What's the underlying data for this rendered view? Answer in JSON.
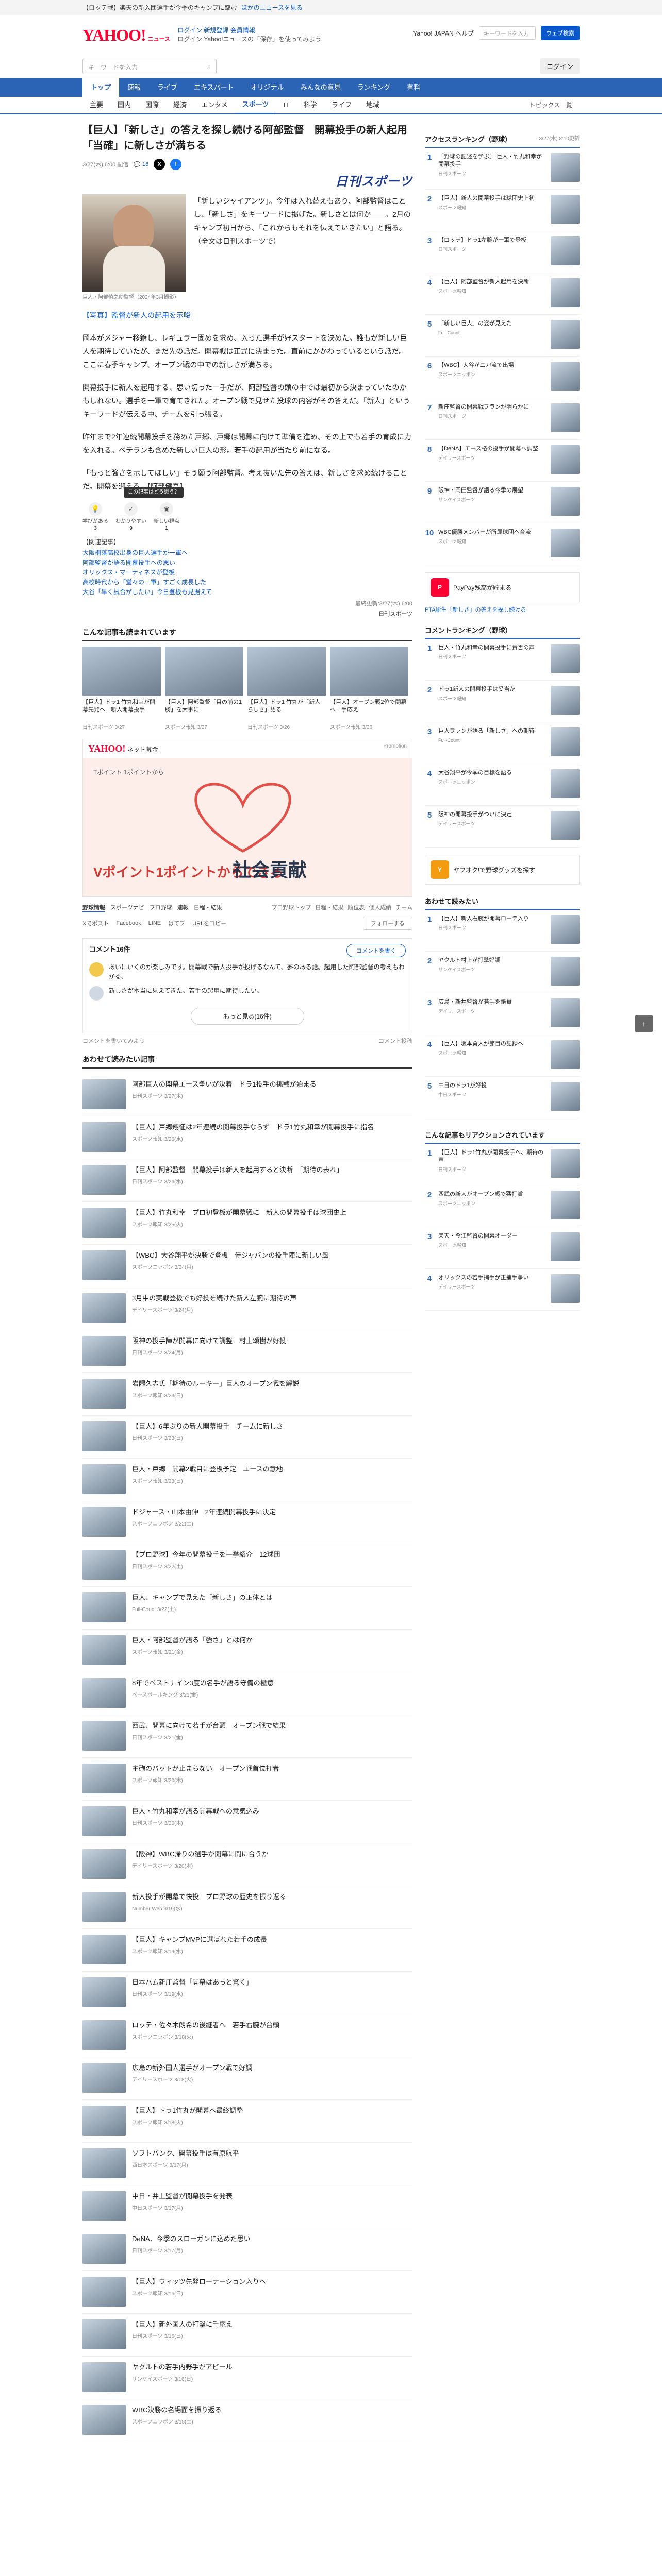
{
  "promo": {
    "text": "【ロッテ戦】楽天の新入団選手が今季のキャンプに臨む",
    "link": "ほかのニュースを見る"
  },
  "header": {
    "logo": "YAHOO!",
    "logo_sub": "ニュース",
    "links_1": "ログイン 新規登録 会員情報",
    "links_2": "ログイン Yahoo!ニュースの「保存」を使ってみよう",
    "right_links": "Yahoo! JAPAN ヘルプ",
    "search_placeholder": "キーワードを入力",
    "search_button": "ウェブ検索"
  },
  "search": {
    "placeholder": "キーワードを入力",
    "right": "ヘルプ",
    "login": "ログイン"
  },
  "gnav": [
    "トップ",
    "速報",
    "ライブ",
    "エキスパート",
    "オリジナル",
    "みんなの意見",
    "ランキング",
    "有料"
  ],
  "snav": [
    "主要",
    "国内",
    "国際",
    "経済",
    "エンタメ",
    "スポーツ",
    "IT",
    "科学",
    "ライフ",
    "地域"
  ],
  "snav_right": "トピックス一覧",
  "article": {
    "title": "【巨人】「新しさ」の答えを探し続ける阿部監督　開幕投手の新人起用「当確」に新しさが満ちる",
    "date": "3/27(木) 6:00 配信",
    "comments": "16",
    "publisher": "日刊スポーツ",
    "caption": "巨人・阿部慎之助監督（2024年3月撮影）",
    "lead": "「新しいジャイアンツ」。今年は入れ替えもあり、阿部監督はことし、「新しさ」をキーワードに掲げた。新しさとは何か――。2月のキャンプ初日から、「これからもそれを伝えていきたい」と語る。（全文は日刊スポーツで）",
    "paras": [
      "【写真】監督が新人の起用を示唆",
      "岡本がメジャー移籍し、レギュラー固めを求め、入った選手が好スタートを決めた。誰もが新しい巨人を期待していたが、まだ先の話だ。開幕戦は正式に決まった。直前にかかわっているという話だ。ここに春季キャンプ、オープン戦の中での新しさが満ちる。",
      "開幕投手に新人を起用する、思い切った一手だが、阿部監督の頭の中では最初から決まっていたのかもしれない。選手を一軍で育てきれた。オープン戦で見せた投球の内容がその答えだ。「新人」というキーワードが伝える中、チームを引っ張る。",
      "昨年まで2年連続開幕投手を務めた戸郷、戸郷は開幕に向けて準備を進め、その上でも若手の育成に力を入れる。ベテランも含めた新しい巨人の形。若手の起用が当たり前になる。",
      "「もっと強さを示してほしい」そう願う阿部監督。考え抜いた先の答えは、新しさを求め続けることだ。開幕を迎える。【阿部健吾】"
    ],
    "react_tip": "この記事はどう思う？",
    "reactions": [
      {
        "label": "学びがある",
        "n": "3"
      },
      {
        "label": "わかりやすい",
        "n": "9"
      },
      {
        "label": "新しい視点",
        "n": "1"
      }
    ],
    "related_head": "【関連記事】",
    "related": [
      "大阪桐蔭高校出身の巨人選手が一軍へ",
      "阿部監督が語る開幕投手への思い",
      "オリックス・マーティネスが登板",
      "高校時代から「堂々の一軍」すごく成長した",
      "大谷「早く試合がしたい」今日登板も見据えて"
    ],
    "updated": "最終更新:3/27(木) 6:00",
    "source": "日刊スポーツ"
  },
  "also_read": {
    "head": "こんな記事も読まれています",
    "cards": [
      {
        "t": "【巨人】ドラ1 竹丸和幸が開幕先発へ　新人開幕投手",
        "s": "日刊スポーツ 3/27"
      },
      {
        "t": "【巨人】阿部監督「目の前の1勝」を大事に",
        "s": "スポーツ報知 3/27"
      },
      {
        "t": "【巨人】ドラ1 竹丸が「新人らしさ」語る",
        "s": "日刊スポーツ 3/26"
      },
      {
        "t": "【巨人】オープン戦2位で開幕へ　手応え",
        "s": "スポーツ報知 3/26"
      }
    ]
  },
  "ad": {
    "brand": "YAHOO!",
    "brand_sub": "ネット募金",
    "pr": "Promotion",
    "caption": "Tポイント 1ポイントから",
    "big_left": "Vポイント1ポイントからできる",
    "big_right": "社会貢献"
  },
  "ranking_bar": {
    "label": "野球情報",
    "tabs": [
      "スポーツナビ",
      "プロ野球",
      "速報",
      "日程・結果"
    ],
    "right": [
      "プロ野球トップ",
      "日程・結果",
      "順位表",
      "個人成績",
      "チーム"
    ]
  },
  "share": {
    "items": [
      "Xでポスト",
      "Facebook",
      "LINE",
      "はてブ",
      "URLをコピー"
    ],
    "follow": "フォローする"
  },
  "comments": {
    "head": "コメント16件",
    "button": "コメントを書く",
    "items": [
      "あいにいくのが楽しみです。開幕戦で新人投手が投げるなんて、夢のある話。起用した阿部監督の考えもわかる。",
      "新しさが本当に見えてきた。若手の起用に期待したい。"
    ],
    "more": "もっと見る(16件)",
    "note_left": "コメントを書いてみよう",
    "note_right": "コメント投稿"
  },
  "reco": {
    "head": "あわせて読みたい記事",
    "items": [
      {
        "t": "阿部巨人の開幕エース争いが決着　ドラ1投手の挑戦が始まる",
        "s": "日刊スポーツ 3/27(木)"
      },
      {
        "t": "【巨人】戸郷翔征は2年連続の開幕投手ならず　ドラ1竹丸和幸が開幕投手に指名",
        "s": "スポーツ報知 3/26(水)"
      },
      {
        "t": "【巨人】阿部監督　開幕投手は新人を起用すると決断　「期待の表れ」",
        "s": "日刊スポーツ 3/26(水)"
      },
      {
        "t": "【巨人】竹丸和幸　プロ初登板が開幕戦に　新人の開幕投手は球団史上",
        "s": "スポーツ報知 3/25(火)"
      },
      {
        "t": "【WBC】大谷翔平が決勝で登板　侍ジャパンの投手陣に新しい風",
        "s": "スポーツニッポン 3/24(月)"
      },
      {
        "t": "3月中の実戦登板でも好投を続けた新人左腕に期待の声",
        "s": "デイリースポーツ 3/24(月)"
      },
      {
        "t": "阪神の投手陣が開幕に向けて調整　村上頌樹が好投",
        "s": "日刊スポーツ 3/24(月)"
      },
      {
        "t": "岩隈久志氏「期待のルーキー」巨人のオープン戦を解説",
        "s": "スポーツ報知 3/23(日)"
      },
      {
        "t": "【巨人】6年ぶりの新人開幕投手　チームに新しさ",
        "s": "日刊スポーツ 3/23(日)"
      },
      {
        "t": "巨人・戸郷　開幕2戦目に登板予定　エースの意地",
        "s": "スポーツ報知 3/23(日)"
      },
      {
        "t": "ドジャース・山本由伸　2年連続開幕投手に決定",
        "s": "スポーツニッポン 3/22(土)"
      },
      {
        "t": "【プロ野球】今年の開幕投手を一挙紹介　12球団",
        "s": "日刊スポーツ 3/22(土)"
      },
      {
        "t": "巨人、キャンプで見えた「新しさ」の正体とは",
        "s": "Full-Count 3/22(土)"
      },
      {
        "t": "巨人・阿部監督が語る「強さ」とは何か",
        "s": "スポーツ報知 3/21(金)"
      },
      {
        "t": "8年でベストナイン3度の名手が語る守備の極意",
        "s": "ベースボールキング 3/21(金)"
      },
      {
        "t": "西武、開幕に向けて若手が台頭　オープン戦で結果",
        "s": "日刊スポーツ 3/21(金)"
      },
      {
        "t": "主砲のバットが止まらない　オープン戦首位打者",
        "s": "スポーツ報知 3/20(木)"
      },
      {
        "t": "巨人・竹丸和幸が語る開幕戦への意気込み",
        "s": "日刊スポーツ 3/20(木)"
      },
      {
        "t": "【阪神】WBC帰りの選手が開幕に間に合うか",
        "s": "デイリースポーツ 3/20(木)"
      },
      {
        "t": "新人投手が開幕で快投　プロ野球の歴史を振り返る",
        "s": "Number Web 3/19(水)"
      },
      {
        "t": "【巨人】キャンプMVPに選ばれた若手の成長",
        "s": "スポーツ報知 3/19(水)"
      },
      {
        "t": "日本ハム新庄監督「開幕はあっと驚く」",
        "s": "日刊スポーツ 3/19(水)"
      },
      {
        "t": "ロッテ・佐々木朗希の後継者へ　若手右腕が台頭",
        "s": "スポーツニッポン 3/18(火)"
      },
      {
        "t": "広島の新外国人選手がオープン戦で好調",
        "s": "デイリースポーツ 3/18(火)"
      },
      {
        "t": "【巨人】ドラ1竹丸が開幕へ最終調整",
        "s": "スポーツ報知 3/18(火)"
      },
      {
        "t": "ソフトバンク、開幕投手は有原航平",
        "s": "西日本スポーツ 3/17(月)"
      },
      {
        "t": "中日・井上監督が開幕投手を発表",
        "s": "中日スポーツ 3/17(月)"
      },
      {
        "t": "DeNA、今季のスローガンに込めた思い",
        "s": "日刊スポーツ 3/17(月)"
      },
      {
        "t": "【巨人】ウィッツ先発ローテーション入りへ",
        "s": "スポーツ報知 3/16(日)"
      },
      {
        "t": "【巨人】新外国人の打撃に手応え",
        "s": "日刊スポーツ 3/16(日)"
      },
      {
        "t": "ヤクルトの若手内野手がアピール",
        "s": "サンケイスポーツ 3/16(日)"
      },
      {
        "t": "WBC決勝の名場面を振り返る",
        "s": "スポーツニッポン 3/15(土)"
      }
    ]
  },
  "side": {
    "access_head": "アクセスランキング（野球）",
    "access_time": "3/27(木) 8:10更新",
    "access": [
      {
        "t": "「野球の記述を学ぶ」 巨人・竹丸和幸が開幕投手",
        "s": "日刊スポーツ"
      },
      {
        "t": "【巨人】新人の開幕投手は球団史上初",
        "s": "スポーツ報知"
      },
      {
        "t": "【ロッテ】ドラ1左腕が一軍で登板",
        "s": "日刊スポーツ"
      },
      {
        "t": "【巨人】阿部監督が新人起用を決断",
        "s": "スポーツ報知"
      },
      {
        "t": "「新しい巨人」の姿が見えた",
        "s": "Full-Count"
      },
      {
        "t": "【WBC】大谷が二刀流で出場",
        "s": "スポーツニッポン"
      },
      {
        "t": "新庄監督の開幕戦プランが明らかに",
        "s": "日刊スポーツ"
      },
      {
        "t": "【DeNA】エース格の投手が開幕へ調整",
        "s": "デイリースポーツ"
      },
      {
        "t": "阪神・岡田監督が語る今季の展望",
        "s": "サンケイスポーツ"
      },
      {
        "t": "WBC優勝メンバーが所属球団へ合流",
        "s": "スポーツ報知"
      }
    ],
    "comment_head": "コメントランキング（野球）",
    "comment": [
      {
        "t": "巨人・竹丸和幸の開幕投手に賛否の声",
        "s": "日刊スポーツ"
      },
      {
        "t": "ドラ1新人の開幕投手は妥当か",
        "s": "スポーツ報知"
      },
      {
        "t": "巨人ファンが語る「新しさ」への期待",
        "s": "Full-Count"
      },
      {
        "t": "大谷翔平が今季の目標を語る",
        "s": "スポーツニッポン"
      },
      {
        "t": "阪神の開幕投手がついに決定",
        "s": "デイリースポーツ"
      }
    ],
    "paypay": "PayPay残高が貯まる",
    "paypay_link": "PTA誕生「新しさ」の答えを探し続ける",
    "banner": "ヤフオク!で野球グッズを探す",
    "reco2_head": "あわせて読みたい",
    "reco2": [
      {
        "t": "【巨人】新人右腕が開幕ローテ入り",
        "s": "日刊スポーツ"
      },
      {
        "t": "ヤクルト村上が打撃好調",
        "s": "サンケイスポーツ"
      },
      {
        "t": "広島・新井監督が若手を絶賛",
        "s": "デイリースポーツ"
      },
      {
        "t": "【巨人】坂本勇人が節目の記録へ",
        "s": "スポーツ報知"
      },
      {
        "t": "中日のドラ1が好投",
        "s": "中日スポーツ"
      }
    ],
    "reaction_head": "こんな記事もリアクションされています",
    "reaction": [
      {
        "t": "【巨人】ドラ1竹丸が開幕投手へ、期待の声",
        "s": "日刊スポーツ"
      },
      {
        "t": "西武の新人がオープン戦で猛打賞",
        "s": "スポーツニッポン"
      },
      {
        "t": "楽天・今江監督の開幕オーダー",
        "s": "スポーツ報知"
      },
      {
        "t": "オリックスの若手捕手が正捕手争い",
        "s": "デイリースポーツ"
      }
    ],
    "to_top": "↑"
  }
}
